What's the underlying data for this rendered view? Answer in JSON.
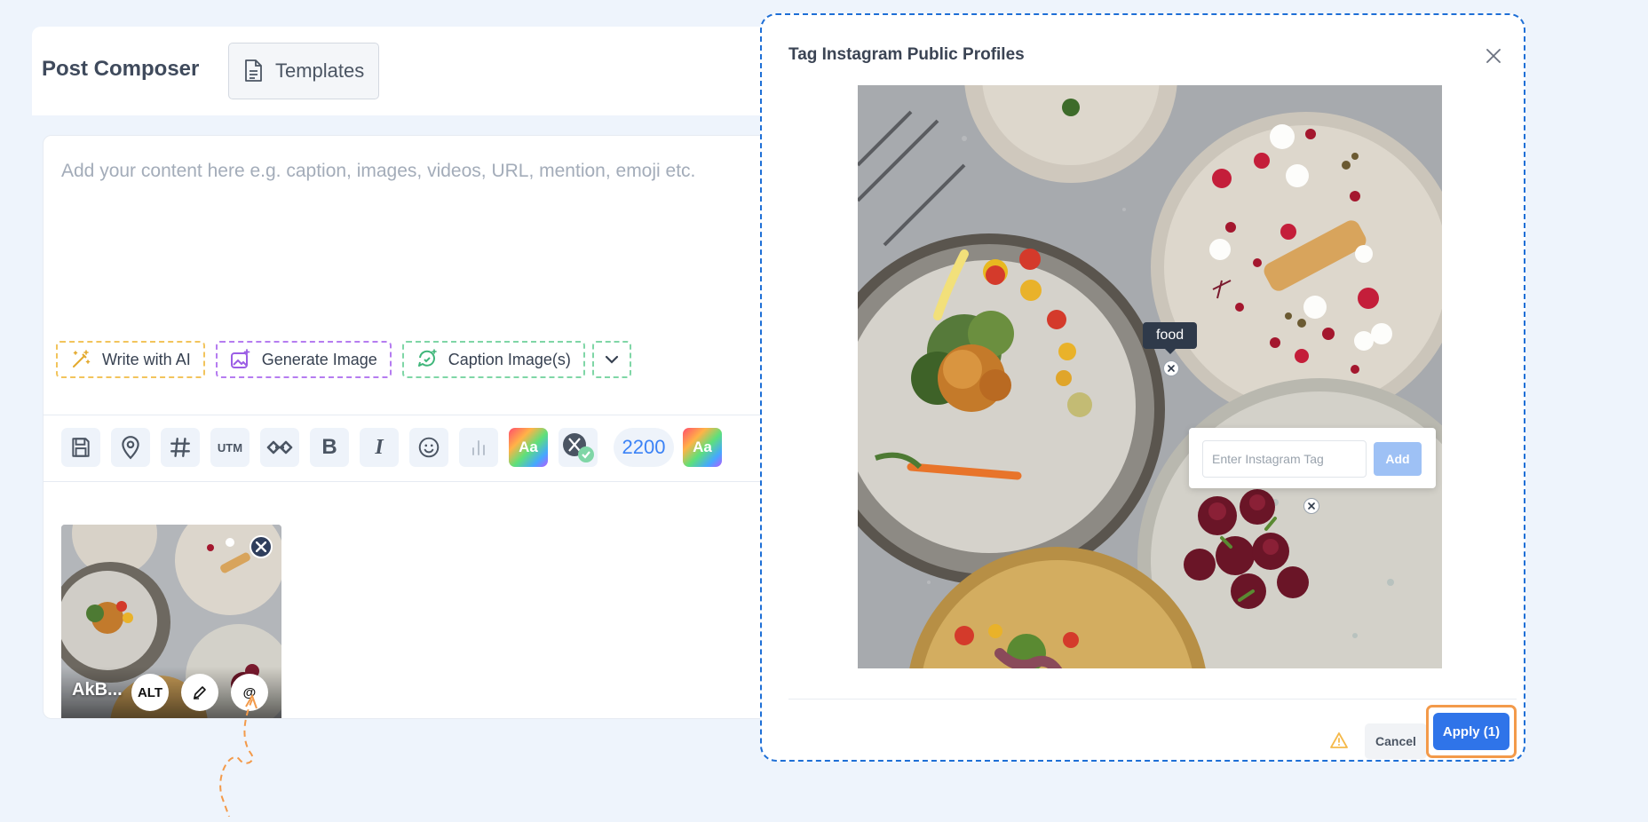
{
  "composer": {
    "title": "Post Composer",
    "templates_label": "Templates",
    "placeholder": "Add your content here e.g. caption, images, videos, URL, mention, emoji etc.",
    "ai_buttons": [
      "Write with AI",
      "Generate Image",
      "Caption Image(s)"
    ],
    "toolbar": {
      "utm": "UTM",
      "bold": "B",
      "italic": "I",
      "font_style": "Aa",
      "char_count": "2200"
    },
    "media": {
      "name": "AkB...",
      "alt_label": "ALT",
      "tag_label": "@"
    }
  },
  "modal": {
    "title": "Tag Instagram Public Profiles",
    "tag_text": "food",
    "input_placeholder": "Enter Instagram Tag",
    "add_label": "Add",
    "cancel_label": "Cancel",
    "apply_label": "Apply (1)"
  },
  "colors": {
    "accent": "#2f74e9",
    "modal_border": "#1e6fd6",
    "highlight": "#f39a4a",
    "ai_yellow": "#f2c45c",
    "ai_purple": "#b57cf0",
    "ai_green": "#7fd6a6"
  }
}
